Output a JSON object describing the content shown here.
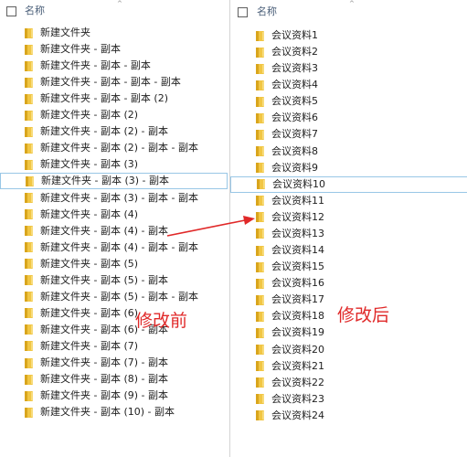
{
  "left": {
    "header_label": "名称",
    "items": [
      "新建文件夹",
      "新建文件夹 - 副本",
      "新建文件夹 - 副本 - 副本",
      "新建文件夹 - 副本 - 副本 - 副本",
      "新建文件夹 - 副本 - 副本 (2)",
      "新建文件夹 - 副本 (2)",
      "新建文件夹 - 副本 (2) - 副本",
      "新建文件夹 - 副本 (2) - 副本 - 副本",
      "新建文件夹 - 副本 (3)",
      "新建文件夹 - 副本 (3) - 副本",
      "新建文件夹 - 副本 (3) - 副本 - 副本",
      "新建文件夹 - 副本 (4)",
      "新建文件夹 - 副本 (4) - 副本",
      "新建文件夹 - 副本 (4) - 副本 - 副本",
      "新建文件夹 - 副本 (5)",
      "新建文件夹 - 副本 (5) - 副本",
      "新建文件夹 - 副本 (5) - 副本 - 副本",
      "新建文件夹 - 副本 (6)",
      "新建文件夹 - 副本 (6) - 副本",
      "新建文件夹 - 副本 (7)",
      "新建文件夹 - 副本 (7) - 副本",
      "新建文件夹 - 副本 (8) - 副本",
      "新建文件夹 - 副本 (9) - 副本",
      "新建文件夹 - 副本 (10) - 副本"
    ],
    "focused_index": 9
  },
  "right": {
    "header_label": "名称",
    "items": [
      "会议资料1",
      "会议资料2",
      "会议资料3",
      "会议资料4",
      "会议资料5",
      "会议资料6",
      "会议资料7",
      "会议资料8",
      "会议资料9",
      "会议资料10",
      "会议资料11",
      "会议资料12",
      "会议资料13",
      "会议资料14",
      "会议资料15",
      "会议资料16",
      "会议资料17",
      "会议资料18",
      "会议资料19",
      "会议资料20",
      "会议资料21",
      "会议资料22",
      "会议资料23",
      "会议资料24"
    ],
    "focused_index": 9
  },
  "annotations": {
    "before": "修改前",
    "after": "修改后",
    "color": "#e02828"
  },
  "icons": {
    "folder": "folder-icon",
    "sort": "sort-arrow-icon",
    "checkbox": "checkbox-icon"
  }
}
